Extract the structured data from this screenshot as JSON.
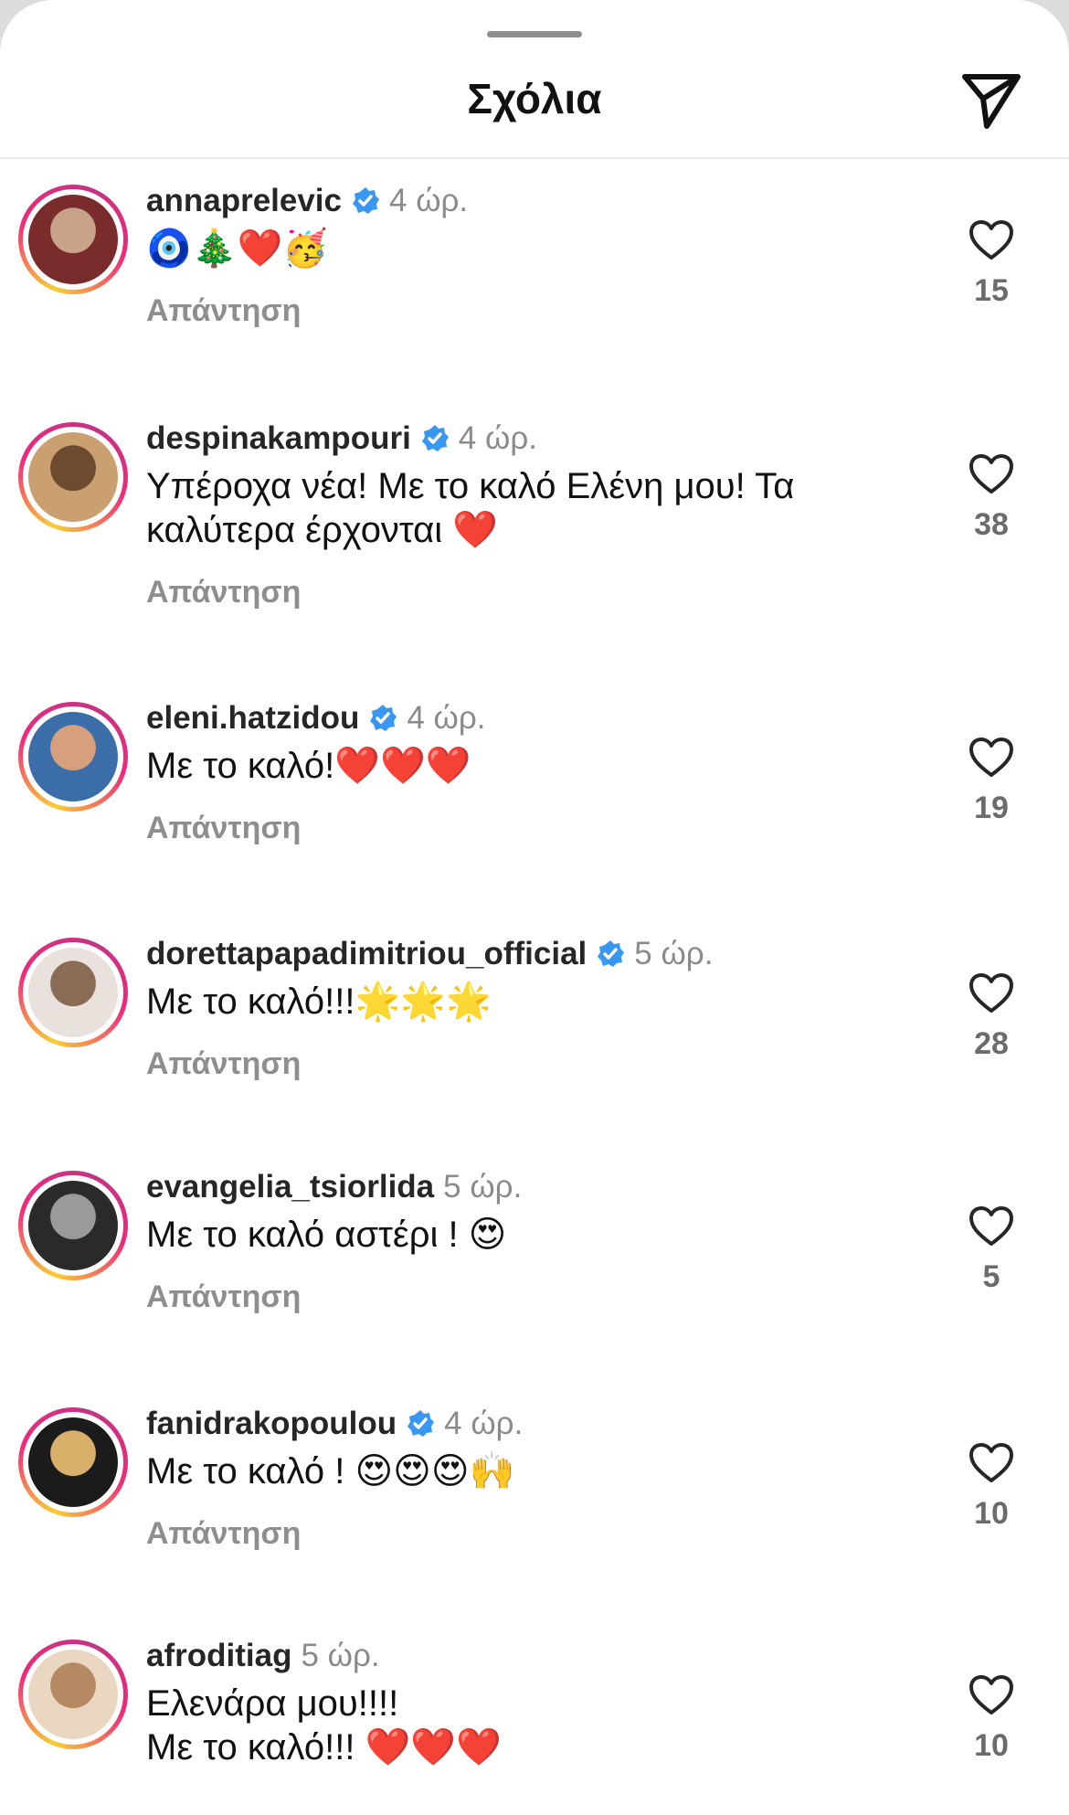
{
  "header": {
    "title": "Σχόλια"
  },
  "comments": [
    {
      "username": "annaprelevic",
      "verified": true,
      "time": "4 ώρ.",
      "text": "🧿🎄❤️🥳",
      "reply": "Απάντηση",
      "likes": "15",
      "avatar_colors": [
        "#7a2b2b",
        "#c8a38a"
      ]
    },
    {
      "username": "despinakampouri",
      "verified": true,
      "time": "4 ώρ.",
      "text": "Υπέροχα νέα! Με το καλό Ελένη μου! Τα καλύτερα έρχονται ❤️",
      "reply": "Απάντηση",
      "likes": "38",
      "avatar_colors": [
        "#caa071",
        "#6e4a2e"
      ]
    },
    {
      "username": "eleni.hatzidou",
      "verified": true,
      "time": "4 ώρ.",
      "text": "Με το καλό!❤️❤️❤️",
      "reply": "Απάντηση",
      "likes": "19",
      "avatar_colors": [
        "#3b6ea8",
        "#d6a07c"
      ]
    },
    {
      "username": "dorettapapadimitriou_official",
      "verified": true,
      "time": "5 ώρ.",
      "text": "Με το καλό!!!🌟🌟🌟",
      "reply": "Απάντηση",
      "likes": "28",
      "avatar_colors": [
        "#e9e2dc",
        "#8a6b55"
      ]
    },
    {
      "username": "evangelia_tsiorlida",
      "verified": false,
      "time": "5 ώρ.",
      "text": "Με το καλό αστέρι ! 😍",
      "reply": "Απάντηση",
      "likes": "5",
      "avatar_colors": [
        "#2a2a2a",
        "#9a9a9a"
      ]
    },
    {
      "username": "fanidrakopoulou",
      "verified": true,
      "time": "4 ώρ.",
      "text": "Με το καλό ! 😍😍😍🙌",
      "reply": "Απάντηση",
      "likes": "10",
      "avatar_colors": [
        "#1b1b1b",
        "#d9b06a"
      ]
    },
    {
      "username": "afroditiag",
      "verified": false,
      "time": "5 ώρ.",
      "text": "Ελενάρα μου!!!!\nΜε το καλό!!! ❤️❤️❤️",
      "reply": "",
      "likes": "10",
      "avatar_colors": [
        "#e9d7c2",
        "#b58a63"
      ]
    }
  ],
  "colors": {
    "verified": "#3897f0",
    "heart_stroke": "#262626"
  }
}
